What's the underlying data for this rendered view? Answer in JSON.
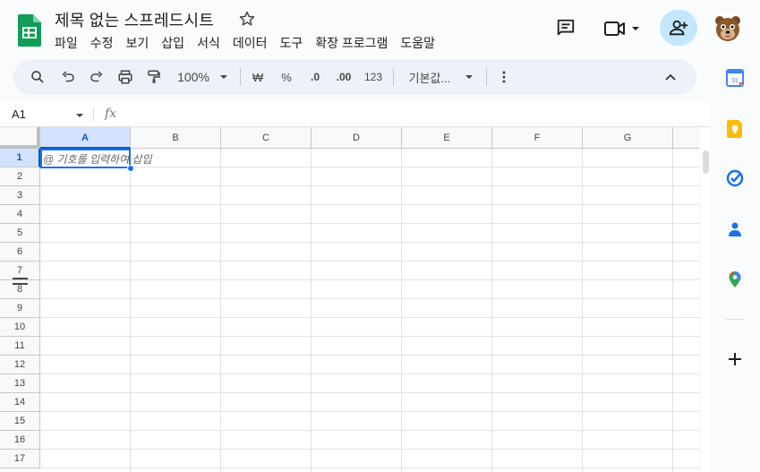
{
  "app": {
    "doc_title": "제목 없는 스프레드시트",
    "menu": [
      "파일",
      "수정",
      "보기",
      "삽입",
      "서식",
      "데이터",
      "도구",
      "확장 프로그램",
      "도움말"
    ]
  },
  "toolbar": {
    "zoom": "100%",
    "currency": "₩",
    "percent": "%",
    "dec_decrease": ".0",
    "dec_increase": ".00",
    "number_format": "123",
    "font": "기본값..."
  },
  "formula_bar": {
    "cell_ref": "A1",
    "fx": "fx"
  },
  "grid": {
    "columns": [
      "A",
      "B",
      "C",
      "D",
      "E",
      "F",
      "G"
    ],
    "rows": [
      "1",
      "2",
      "3",
      "4",
      "5",
      "6",
      "7",
      "8",
      "9",
      "10",
      "11",
      "12",
      "13",
      "14",
      "15",
      "16",
      "17"
    ],
    "active_cell": "A1",
    "hint_text": "@ 기호를 입력하여 삽입"
  },
  "colors": {
    "accent": "#1a73e8",
    "share_bg": "#c2e7ff",
    "toolbar_bg": "#edf2fa",
    "sheets_green": "#0f9d58"
  },
  "side_panel": {
    "icons": [
      "calendar-icon",
      "keep-icon",
      "tasks-icon",
      "contacts-icon",
      "maps-icon",
      "add-icon"
    ],
    "calendar_day": "31"
  }
}
